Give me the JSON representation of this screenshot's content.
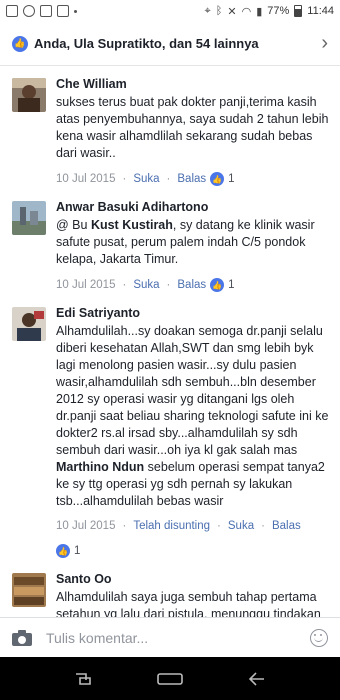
{
  "status_bar": {
    "battery": "77%",
    "time": "11:44"
  },
  "reactions": {
    "text": "Anda, Ula Supratikto, dan 54 lainnya"
  },
  "comments": [
    {
      "name": "Che William",
      "text": "sukses terus buat pak dokter panji,terima kasih atas penyembuhannya, saya sudah 2 tahun lebih kena wasir alhamdlilah sekarang sudah bebas dari wasir..",
      "date": "10 Jul 2015",
      "like_label": "Suka",
      "reply_label": "Balas",
      "likes": "1"
    },
    {
      "name": "Anwar Basuki Adihartono",
      "text_prefix": "@ Bu ",
      "mention": "Kust Kustirah",
      "text_suffix": ", sy datang ke klinik wasir safute pusat, perum palem indah C/5 pondok kelapa, Jakarta Timur.",
      "date": "10 Jul 2015",
      "like_label": "Suka",
      "reply_label": "Balas",
      "likes": "1"
    },
    {
      "name": "Edi Satriyanto",
      "text_prefix": "Alhamdulilah...sy doakan semoga dr.panji selalu diberi kesehatan Allah,SWT dan smg lebih byk lagi menolong  pasien wasir...sy dulu  pasien wasir,alhamdulilah sdh sembuh...bln desember 2012 sy operasi wasir yg ditangani lgs oleh dr.panji saat beliau sharing teknologi safute ini ke dokter2 rs.al irsad sby...alhamdulilah sy sdh sembuh dari wasir...oh iya kl gak salah mas ",
      "mention": "Marthino Ndun",
      "text_suffix": " sebelum operasi sempat tanya2 ke sy ttg operasi yg sdh pernah sy lakukan tsb...alhamdulilah bebas wasir",
      "date": "10 Jul 2015",
      "translate_label": "Telah disunting",
      "like_label": "Suka",
      "reply_label": "Balas",
      "likes": "1"
    },
    {
      "name": "Santo Oo",
      "text": "Alhamdulilah saya juga sembuh tahap pertama setahun yg lalu dari pistula, menunggu tindakan ke dua. Terimakasih doktet Panji. Sukses selalu"
    }
  ],
  "compose": {
    "placeholder": "Tulis komentar..."
  },
  "colors": {
    "accent": "#4a76e8",
    "link": "#4b6fb0",
    "meta": "#90949c"
  }
}
